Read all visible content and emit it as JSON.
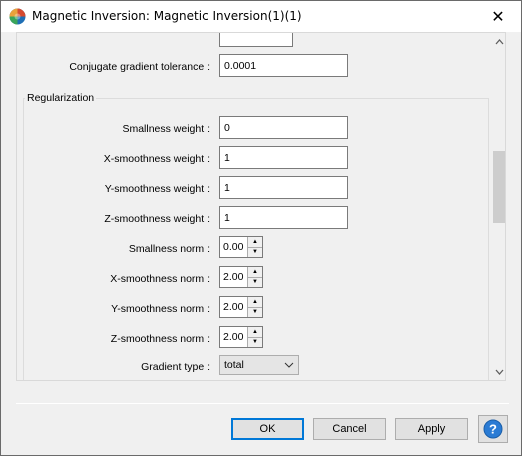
{
  "window": {
    "title": "Magnetic Inversion: Magnetic Inversion(1)(1)",
    "close_glyph": "✕",
    "app_icon": "app-globe-icon"
  },
  "form": {
    "cg_tolerance": {
      "label": "Conjugate gradient tolerance :",
      "value": "0.0001"
    },
    "regularization_group": "Regularization",
    "smallness_weight": {
      "label": "Smallness weight :",
      "value": "0"
    },
    "x_smoothness_weight": {
      "label": "X-smoothness weight :",
      "value": "1"
    },
    "y_smoothness_weight": {
      "label": "Y-smoothness weight :",
      "value": "1"
    },
    "z_smoothness_weight": {
      "label": "Z-smoothness weight :",
      "value": "1"
    },
    "smallness_norm": {
      "label": "Smallness norm :",
      "value": "0.00"
    },
    "x_smoothness_norm": {
      "label": "X-smoothness norm :",
      "value": "2.00"
    },
    "y_smoothness_norm": {
      "label": "Y-smoothness norm :",
      "value": "2.00"
    },
    "z_smoothness_norm": {
      "label": "Z-smoothness norm :",
      "value": "2.00"
    },
    "gradient_type": {
      "label": "Gradient type :",
      "value": "total"
    }
  },
  "buttons": {
    "ok": "OK",
    "cancel": "Cancel",
    "apply": "Apply",
    "help_glyph": "?"
  },
  "colors": {
    "accent": "#0078d7",
    "help_icon": "#2a7bd4"
  }
}
